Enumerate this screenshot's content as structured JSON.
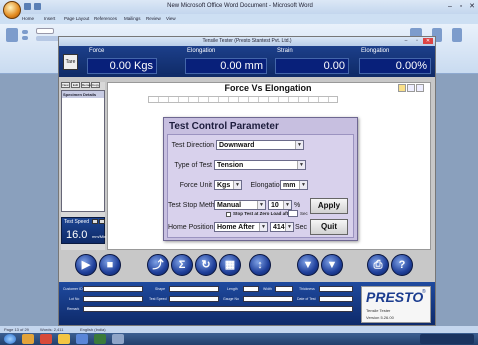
{
  "word": {
    "title": "New Microsoft Office Word Document - Microsoft Word",
    "tabs": [
      "Home",
      "Insert",
      "Page Layout",
      "References",
      "Mailings",
      "Review",
      "View"
    ],
    "status": {
      "page": "Page 13 of 29",
      "words": "Words: 2,411",
      "language": "English (India)"
    }
  },
  "app": {
    "title": "Tensile Tester   (Presto Stantest Pvt. Ltd.)",
    "readouts": {
      "force_label": "Force",
      "force_value": "0.00 Kgs",
      "elongation_label": "Elongation",
      "elongation_value": "0.00 mm",
      "strain_label": "Strain",
      "strain_value": "0.00",
      "elong_pct_label": "Elongation",
      "elong_pct_value": "0.00%"
    },
    "tare_label": "Tare",
    "left_buttons": [
      "New",
      "Edit",
      "Remove",
      "Copy"
    ],
    "specimen_header": "Specimen Details",
    "test_speed": {
      "label": "Test Speed",
      "value": "16.0",
      "unit": "mm/Min"
    },
    "chart_title": "Force Vs Elongation"
  },
  "dialog": {
    "title": "Test Control Parameter",
    "test_direction_label": "Test Direction",
    "test_direction_value": "Downward",
    "type_of_test_label": "Type of Test",
    "type_of_test_value": "Tension",
    "force_unit_label": "Force Unit",
    "force_unit_value": "Kgs",
    "elong_unit_label": "Elongation Unit",
    "elong_unit_value": "mm",
    "test_stop_label": "Test Stop Method",
    "test_stop_value": "Manual",
    "test_stop_pct": "10",
    "pct_symbol": "%",
    "stop_zero_label": "Stop Test at Zero Load after",
    "stop_zero_unit": "Sec",
    "home_position_label": "Home Position",
    "home_position_value": "Home After",
    "home_after_value": "414",
    "home_after_unit": "Sec",
    "apply_label": "Apply",
    "quit_label": "Quit"
  },
  "controls": {
    "icons": [
      "play-icon",
      "stop-icon",
      "up-icon",
      "zoom-icon",
      "refresh-icon",
      "grid-icon",
      "arrow-icon",
      "down-icon",
      "down2-icon",
      "print-icon",
      "help-icon"
    ]
  },
  "bottom_form": {
    "labels": [
      "Customer ID",
      "Lot No",
      "Remark",
      "Shape",
      "Test Speed",
      "Length",
      "Gauge No",
      "Width",
      "Date of Test",
      "Thickness"
    ],
    "brand": "PRESTO",
    "brand_sub": "Tensile Tester",
    "version": "Version 5.26.00"
  },
  "colors": {
    "readout_bg": "#0f2a66",
    "dialog_bg": "#c7bfe0",
    "accent": "#1f3f9a"
  }
}
